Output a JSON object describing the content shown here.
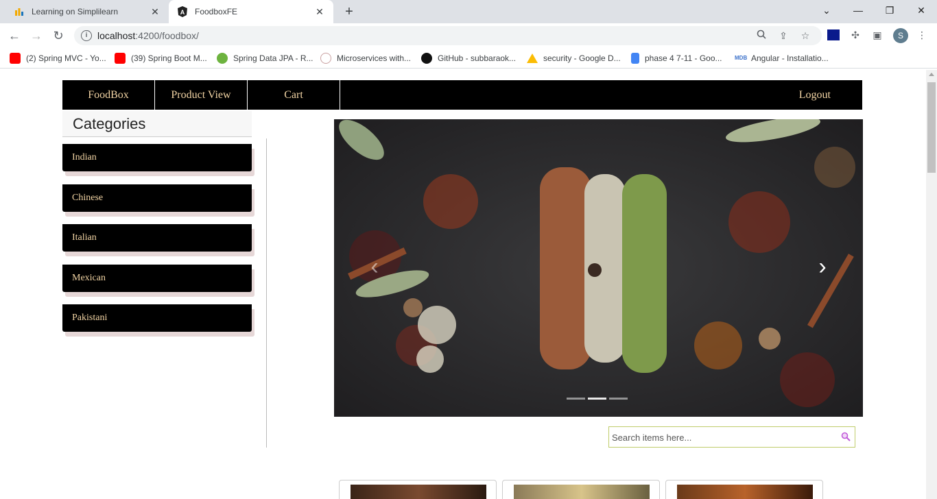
{
  "browser": {
    "tabs": [
      {
        "title": "Learning on Simplilearn",
        "icon": "simplilearn-icon",
        "active": false
      },
      {
        "title": "FoodboxFE",
        "icon": "angular-icon",
        "active": true
      }
    ],
    "url_host": "localhost",
    "url_rest": ":4200/foodbox/",
    "bookmarks": [
      {
        "label": "(2) Spring MVC - Yo...",
        "icon": "youtube-icon",
        "color": "#ff0000"
      },
      {
        "label": "(39) Spring Boot M...",
        "icon": "youtube-icon",
        "color": "#ff0000"
      },
      {
        "label": "Spring Data JPA - R...",
        "icon": "spring-icon",
        "color": "#6db33f"
      },
      {
        "label": "Microservices with...",
        "icon": "microservices-icon",
        "color": "#c9a0a0"
      },
      {
        "label": "GitHub - subbaraok...",
        "icon": "github-icon",
        "color": "#111111"
      },
      {
        "label": "security - Google D...",
        "icon": "google-drive-icon",
        "color": "#fbbc04"
      },
      {
        "label": "phase 4 7-11 - Goo...",
        "icon": "google-docs-icon",
        "color": "#4285f4"
      },
      {
        "label": "Angular - Installatio...",
        "icon": "mdb-icon",
        "color": "#3b71ca"
      }
    ],
    "profile_initial": "S"
  },
  "app": {
    "nav": [
      "FoodBox",
      "Product View",
      "Cart"
    ],
    "logout": "Logout",
    "categories_title": "Categories",
    "categories": [
      "Indian",
      "Chinese",
      "Italian",
      "Mexican",
      "Pakistani"
    ],
    "carousel": {
      "slides": 3,
      "active_slide": 2
    },
    "search_placeholder": "Search items here..."
  },
  "colors": {
    "nav_bg": "#000000",
    "nav_text": "#f3d5a5",
    "search_border": "#bfcc6a",
    "search_icon": "#c05ad8"
  }
}
